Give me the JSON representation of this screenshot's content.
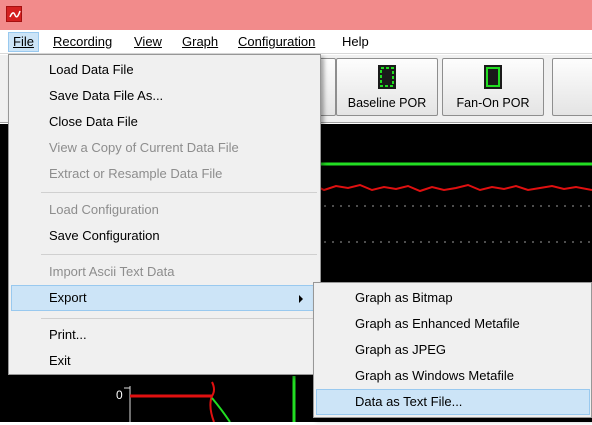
{
  "menubar": {
    "items": [
      {
        "label": "File",
        "mnemonic_index": 0
      },
      {
        "label": "Recording",
        "mnemonic_index": 0
      },
      {
        "label": "View",
        "mnemonic_index": 0
      },
      {
        "label": "Graph",
        "mnemonic_index": 0
      },
      {
        "label": "Configuration",
        "mnemonic_index": 0
      },
      {
        "label": "Help",
        "mnemonic_index": -1
      }
    ]
  },
  "toolbar": {
    "buttons": [
      {
        "label": "Baseline POR",
        "icon": "baseline-por-icon"
      },
      {
        "label": "Fan-On POR",
        "icon": "fan-on-por-icon"
      }
    ]
  },
  "file_menu": {
    "items": [
      {
        "label": "Load Data File",
        "mnemonic": "o",
        "enabled": true
      },
      {
        "label": "Save Data File As...",
        "mnemonic": "S",
        "enabled": true
      },
      {
        "label": "Close Data File",
        "mnemonic": "C",
        "enabled": true
      },
      {
        "label": "View a Copy of Current Data File",
        "mnemonic": "V",
        "enabled": false
      },
      {
        "label": "Extract or Resample Data File",
        "mnemonic": "R",
        "enabled": false
      },
      {
        "label": "Load Configuration",
        "mnemonic": "",
        "enabled": false
      },
      {
        "label": "Save Configuration",
        "mnemonic": "u",
        "enabled": true
      },
      {
        "label": "Import Ascii Text Data",
        "mnemonic": "I",
        "enabled": false
      },
      {
        "label": "Export",
        "mnemonic": "E",
        "enabled": true,
        "has_submenu": true
      },
      {
        "label": "Print...",
        "mnemonic": "P",
        "enabled": true
      },
      {
        "label": "Exit",
        "mnemonic": "x",
        "enabled": true
      }
    ]
  },
  "export_submenu": {
    "items": [
      {
        "label": "Graph as Bitmap",
        "mnemonic": "B"
      },
      {
        "label": "Graph as Enhanced Metafile",
        "mnemonic": "E"
      },
      {
        "label": "Graph as JPEG",
        "mnemonic": "J"
      },
      {
        "label": "Graph as Windows Metafile",
        "mnemonic": "W"
      },
      {
        "label": "Data as Text File...",
        "mnemonic": "T"
      }
    ]
  },
  "graph": {
    "axis_label": "0",
    "colors": {
      "trace_red": "#e01010",
      "trace_green": "#22dd22",
      "background": "#000000"
    }
  }
}
